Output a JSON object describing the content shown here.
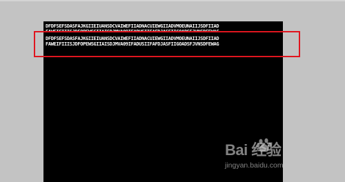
{
  "console": {
    "lines": [
      "DFDFSEFSDASFAJKGIIEIUANSDCVAIWEFIIADNACUIEWGIIADVMOEUNAIIJSDFIIAD",
      "FAWEIFIIISJDFOPEWSGIIAISDJMVA09IFADUSIIFAFDJASFIIGOADSFJVNSDFEWAG",
      "DFDFSEFSDASFAJKGIIEIUANSDCVAIWEFIIADNACUIEWGIIADVMOEUNAIIJSDFIIAD",
      "FAWEIFIIISJDFOPEWSGIIAISDJMVA09IFADUSIIFAFDJASFIIGOADSFJVNSDFEWAG"
    ]
  },
  "watermark": {
    "logo": "Bai  经验",
    "subtext": "jingyan.baidu.com"
  },
  "colors": {
    "background": "#c3c3c3",
    "console_bg": "#000000",
    "text": "#ffffff",
    "highlight": "#e0151e"
  }
}
